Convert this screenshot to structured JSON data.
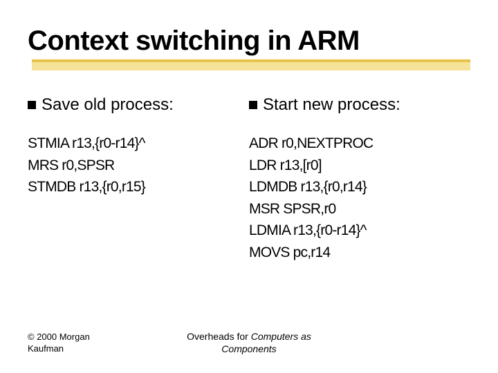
{
  "title": "Context switching in ARM",
  "left": {
    "heading": "Save old process:",
    "lines": [
      "STMIA r13,{r0-r14}^",
      "MRS r0,SPSR",
      "STMDB r13,{r0,r15}"
    ]
  },
  "right": {
    "heading": "Start new process:",
    "lines": [
      "ADR r0,NEXTPROC",
      "LDR r13,[r0]",
      "LDMDB r13,{r0,r14}",
      "MSR SPSR,r0",
      "LDMIA r13,{r0-r14}^",
      "MOVS pc,r14"
    ]
  },
  "footer": {
    "copyright_line1": "© 2000 Morgan",
    "copyright_line2": "Kaufman",
    "caption_prefix": "Overheads for ",
    "caption_italic": "Computers as",
    "caption_line2": "Components"
  }
}
